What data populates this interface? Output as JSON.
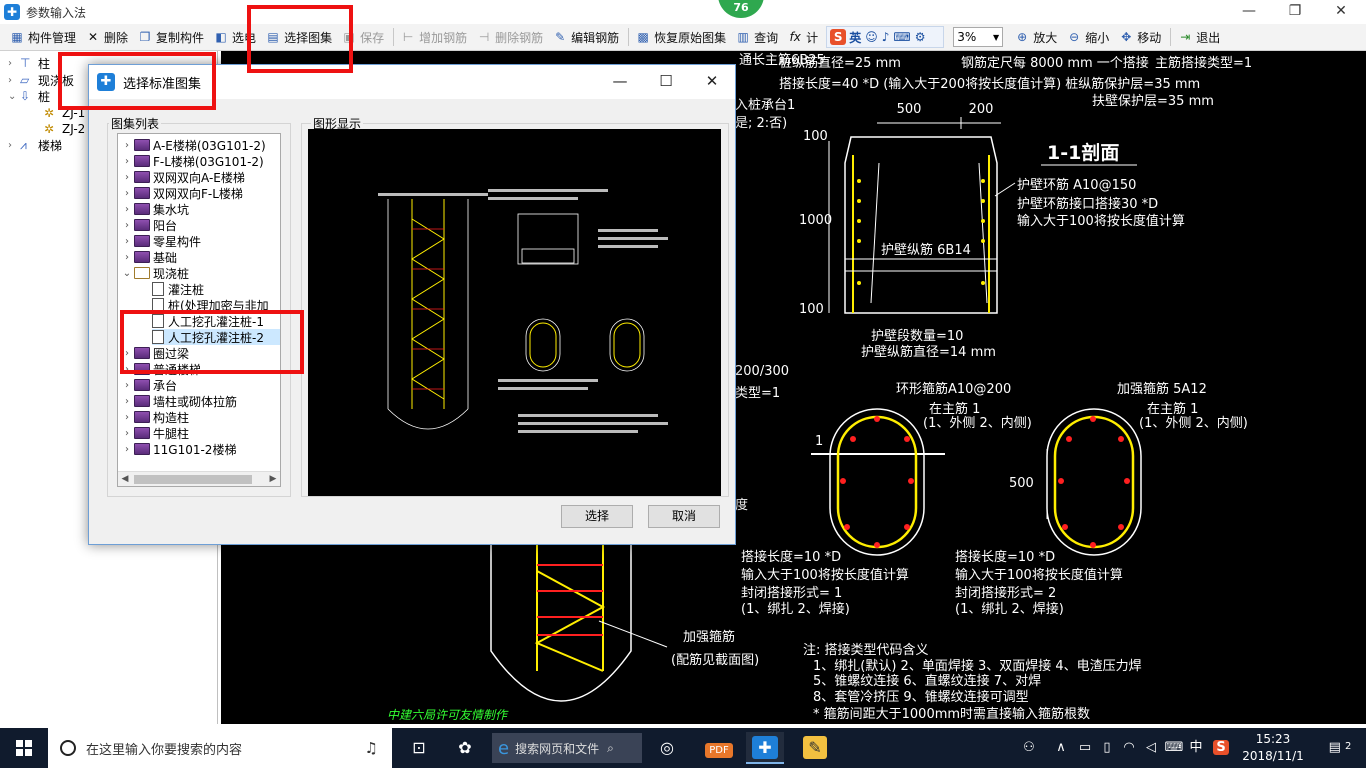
{
  "window": {
    "title": "参数输入法",
    "badge": "76",
    "controls": {
      "minimize": "—",
      "restore": "❐",
      "close": "✕"
    }
  },
  "toolbar": {
    "items": [
      {
        "label": "构件管理",
        "icon": "table-icon"
      },
      {
        "label": "删除",
        "icon": "delete-icon"
      },
      {
        "label": "复制构件",
        "icon": "copy-icon"
      },
      {
        "label": "选电",
        "icon": "pick-icon"
      },
      {
        "label": "选择图集",
        "icon": "atlas-icon"
      },
      {
        "label": "保存",
        "icon": "save-icon",
        "disabled": true
      },
      {
        "label": "增加钢筋",
        "icon": "add-rebar-icon",
        "disabled": true
      },
      {
        "label": "删除钢筋",
        "icon": "delete-rebar-icon",
        "disabled": true
      },
      {
        "label": "编辑钢筋",
        "icon": "edit-rebar-icon"
      },
      {
        "label": "恢复原始图集",
        "icon": "restore-icon"
      },
      {
        "label": "查询",
        "icon": "query-icon"
      },
      {
        "label": "计",
        "icon": "calc-icon"
      }
    ],
    "zoom_value": "3%",
    "right_items": [
      {
        "label": "放大",
        "icon": "zoom-in-icon"
      },
      {
        "label": "缩小",
        "icon": "zoom-out-icon"
      },
      {
        "label": "移动",
        "icon": "move-icon"
      },
      {
        "label": "退出",
        "icon": "exit-icon"
      }
    ],
    "ime": {
      "lang": "英"
    }
  },
  "left_tree": {
    "items": [
      {
        "label": "柱",
        "exp": "›",
        "indent": 0
      },
      {
        "label": "现浇板",
        "exp": "›",
        "indent": 0
      },
      {
        "label": "桩",
        "exp": "⌄",
        "indent": 0
      },
      {
        "label": "ZJ-1",
        "exp": "",
        "indent": 1
      },
      {
        "label": "ZJ-2",
        "exp": "",
        "indent": 1
      },
      {
        "label": "楼梯",
        "exp": "›",
        "indent": 0
      }
    ]
  },
  "dialog": {
    "title": "选择标准图集",
    "list_label": "图集列表",
    "preview_label": "图形显示",
    "select_button": "选择",
    "cancel_button": "取消",
    "tree": [
      {
        "label": "A-E楼梯(03G101-2)",
        "level": 0,
        "type": "book"
      },
      {
        "label": "F-L楼梯(03G101-2)",
        "level": 0,
        "type": "book"
      },
      {
        "label": "双网双向A-E楼梯",
        "level": 0,
        "type": "book"
      },
      {
        "label": "双网双向F-L楼梯",
        "level": 0,
        "type": "book"
      },
      {
        "label": "集水坑",
        "level": 0,
        "type": "book"
      },
      {
        "label": "阳台",
        "level": 0,
        "type": "book"
      },
      {
        "label": "零星构件",
        "level": 0,
        "type": "book"
      },
      {
        "label": "基础",
        "level": 0,
        "type": "book"
      },
      {
        "label": "现浇桩",
        "level": 0,
        "type": "open"
      },
      {
        "label": "灌注桩",
        "level": 1,
        "type": "doc"
      },
      {
        "label": "桩(处理加密与非加",
        "level": 1,
        "type": "doc"
      },
      {
        "label": "人工挖孔灌注桩-1",
        "level": 1,
        "type": "doc"
      },
      {
        "label": "人工挖孔灌注桩-2",
        "level": 1,
        "type": "doc",
        "selected": true
      },
      {
        "label": "圈过梁",
        "level": 0,
        "type": "book"
      },
      {
        "label": "普通楼梯",
        "level": 0,
        "type": "book"
      },
      {
        "label": "承台",
        "level": 0,
        "type": "book"
      },
      {
        "label": "墙柱或砌体拉筋",
        "level": 0,
        "type": "book"
      },
      {
        "label": "构造柱",
        "level": 0,
        "type": "book"
      },
      {
        "label": "牛腿柱",
        "level": 0,
        "type": "book"
      },
      {
        "label": "11G101-2楼梯",
        "level": 0,
        "type": "book"
      }
    ]
  },
  "cad": {
    "top_texts": {
      "t1": "通长主筋6B25",
      "t2": "桩纵筋直径=25 mm",
      "t3": "钢筋定尺每 8000 mm 一个搭接",
      "t4": "主筋搭接类型=1",
      "t5": "搭接长度=40  *D (输入大于200将按长度值计算) 桩纵筋保护层=35 mm",
      "t6": "扶壁保护层=35 mm",
      "t7": "入桩承台1",
      "t8": "是; 2:否)"
    },
    "section": {
      "title": "1-1剖面",
      "dim_500": "500",
      "dim_200": "200",
      "dim_100_top": "100",
      "dim_1000": "1000",
      "dim_100_bot": "100",
      "ring_bar": "护壁环筋 A10@150",
      "ring_lap": "护壁环筋接口搭接30 *D",
      "ring_note": "输入大于100将按长度值计算",
      "long_bar": "护壁纵筋 6B14",
      "seg_count": "护壁段数量=10",
      "long_dia": "护壁纵筋直径=14 mm"
    },
    "mid_texts": {
      "spacing": "200/300",
      "type": "类型=1",
      "degree": "度"
    },
    "left_ring": {
      "title": "环形箍筋A10@200",
      "pos": "在主筋 1",
      "pos_opts": "(1、外侧  2、内侧)",
      "marker": "1",
      "lap": "搭接长度=10  *D",
      "lap_note": "输入大于100将按长度值计算",
      "close": "封闭搭接形式= 1",
      "close_opts": "(1、绑扎  2、焊接)"
    },
    "right_ring": {
      "title": "加强箍筋 5A12",
      "pos": "在主筋 1",
      "pos_opts": "(1、外侧  2、内侧)",
      "dim_500": "500",
      "lap": "搭接长度=10  *D",
      "lap_note": "输入大于100将按长度值计算",
      "close": "封闭搭接形式= 2",
      "close_opts": "(1、绑扎  2、焊接)"
    },
    "pile": {
      "label1": "加强箍筋",
      "label2": "(配筋见截面图)"
    },
    "notes": {
      "title": "注: 搭接类型代码含义",
      "l1": "1、绑扎(默认)  2、单面焊接   3、双面焊接   4、电渣压力焊",
      "l2": "5、锥螺纹连接   6、直螺纹连接   7、对焊",
      "l3": "8、套管冷挤压   9、锥螺纹连接可调型",
      "l4": "* 箍筋间距大于1000mm时需直接输入箍筋根数"
    },
    "watermark": "中建六局许可友情制作"
  },
  "taskbar": {
    "search_placeholder": "在这里输入你要搜索的内容",
    "browser_search": "搜索网页和文件",
    "ime_lang": "中",
    "time": "15:23",
    "date": "2018/11/1",
    "notifications": "2"
  },
  "colors": {
    "canvas": "#000000",
    "cad_text": "#ffffff",
    "cad_green": "#33ff33",
    "cad_yellow": "#ffee00",
    "cad_red": "#ff2020",
    "highlight": "#ee1111"
  }
}
